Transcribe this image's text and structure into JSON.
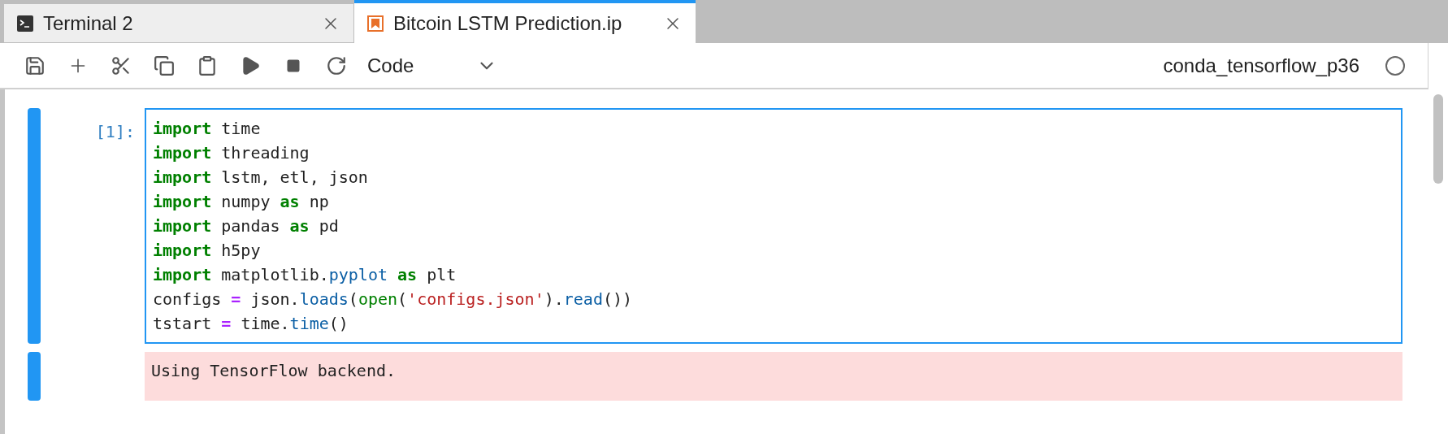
{
  "tabs": [
    {
      "kind": "terminal",
      "label": "Terminal 2",
      "selected": false
    },
    {
      "kind": "notebook",
      "label": "Bitcoin LSTM Prediction.ip",
      "selected": true
    }
  ],
  "toolbar": {
    "cell_type": "Code",
    "kernel": {
      "name": "conda_tensorflow_p36",
      "busy": false
    }
  },
  "cells": [
    {
      "prompt": "[1]:",
      "active": true,
      "lines": [
        [
          {
            "kind": "keyword",
            "text": "import"
          },
          {
            "kind": "plain",
            "text": " time"
          }
        ],
        [
          {
            "kind": "keyword",
            "text": "import"
          },
          {
            "kind": "plain",
            "text": " threading"
          }
        ],
        [
          {
            "kind": "keyword",
            "text": "import"
          },
          {
            "kind": "plain",
            "text": " lstm, etl, json"
          }
        ],
        [
          {
            "kind": "keyword",
            "text": "import"
          },
          {
            "kind": "plain",
            "text": " numpy "
          },
          {
            "kind": "keyword",
            "text": "as"
          },
          {
            "kind": "plain",
            "text": " np"
          }
        ],
        [
          {
            "kind": "keyword",
            "text": "import"
          },
          {
            "kind": "plain",
            "text": " pandas "
          },
          {
            "kind": "keyword",
            "text": "as"
          },
          {
            "kind": "plain",
            "text": " pd"
          }
        ],
        [
          {
            "kind": "keyword",
            "text": "import"
          },
          {
            "kind": "plain",
            "text": " h5py"
          }
        ],
        [
          {
            "kind": "keyword",
            "text": "import"
          },
          {
            "kind": "plain",
            "text": " matplotlib."
          },
          {
            "kind": "attribute",
            "text": "pyplot "
          },
          {
            "kind": "keyword",
            "text": "as"
          },
          {
            "kind": "plain",
            "text": " plt"
          }
        ],
        [
          {
            "kind": "plain",
            "text": "configs "
          },
          {
            "kind": "operator",
            "text": "="
          },
          {
            "kind": "plain",
            "text": " json."
          },
          {
            "kind": "attribute",
            "text": "loads"
          },
          {
            "kind": "plain",
            "text": "("
          },
          {
            "kind": "builtin",
            "text": "open"
          },
          {
            "kind": "plain",
            "text": "("
          },
          {
            "kind": "string",
            "text": "'configs.json'"
          },
          {
            "kind": "plain",
            "text": ")."
          },
          {
            "kind": "attribute",
            "text": "read"
          },
          {
            "kind": "plain",
            "text": "())"
          }
        ],
        [
          {
            "kind": "plain",
            "text": "tstart "
          },
          {
            "kind": "operator",
            "text": "="
          },
          {
            "kind": "plain",
            "text": " time."
          },
          {
            "kind": "attribute",
            "text": "time"
          },
          {
            "kind": "plain",
            "text": "()"
          }
        ]
      ],
      "output": {
        "kind": "stderr",
        "text": "Using TensorFlow backend."
      }
    }
  ]
}
